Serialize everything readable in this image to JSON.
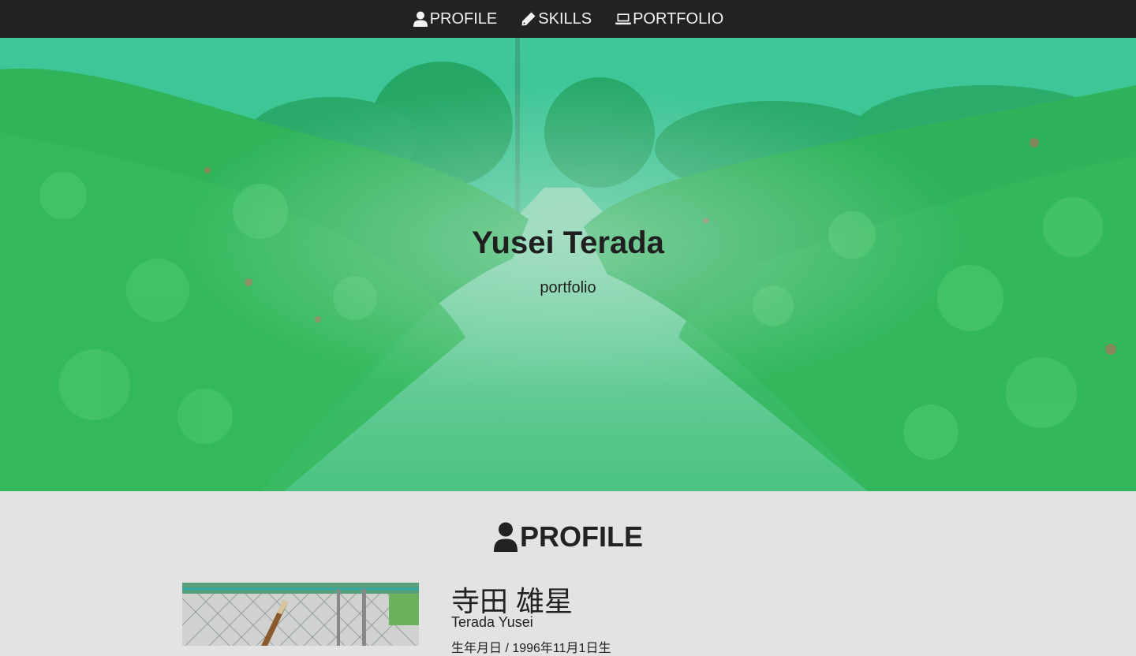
{
  "nav": {
    "items": [
      {
        "label": "PROFILE",
        "icon": "user-icon"
      },
      {
        "label": "SKILLS",
        "icon": "pencil-icon"
      },
      {
        "label": "PORTFOLIO",
        "icon": "laptop-icon"
      }
    ]
  },
  "hero": {
    "title": "Yusei Terada",
    "subtitle": "portfolio",
    "overlay_color": "#2dbd78"
  },
  "profile": {
    "section_title": "PROFILE",
    "name_jp": "寺田 雄星",
    "name_en": "Terada Yusei",
    "birth": "生年月日 / 1996年11月1日生"
  },
  "colors": {
    "nav_bg": "#222222",
    "section_bg": "#e3e3e3"
  }
}
